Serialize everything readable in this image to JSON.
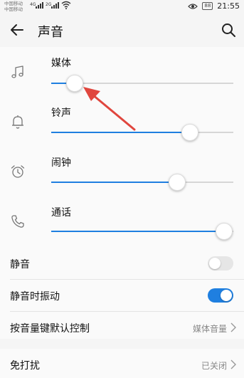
{
  "status_bar": {
    "carrier_1": "中国移动",
    "carrier_2": "中国移动",
    "net_1": "4G",
    "net_2": "2G",
    "battery": "88",
    "time": "21:55"
  },
  "header": {
    "title": "声音"
  },
  "volume": {
    "items": [
      {
        "label": "媒体",
        "icon": "music-note-icon",
        "level": 0.13
      },
      {
        "label": "铃声",
        "icon": "bell-icon",
        "level": 0.76
      },
      {
        "label": "闹钟",
        "icon": "alarm-clock-icon",
        "level": 0.69
      },
      {
        "label": "通话",
        "icon": "phone-icon",
        "level": 0.95
      }
    ]
  },
  "settings": {
    "mute_label": "静音",
    "mute_on": false,
    "vibrate_on_mute_label": "静音时振动",
    "vibrate_on_mute_on": true,
    "volume_key_label": "按音量键默认控制",
    "volume_key_value": "媒体音量",
    "dnd_label": "免打扰",
    "dnd_value": "已关闭"
  },
  "colors": {
    "accent": "#1f7fe0",
    "annotation": "#e0463e"
  }
}
